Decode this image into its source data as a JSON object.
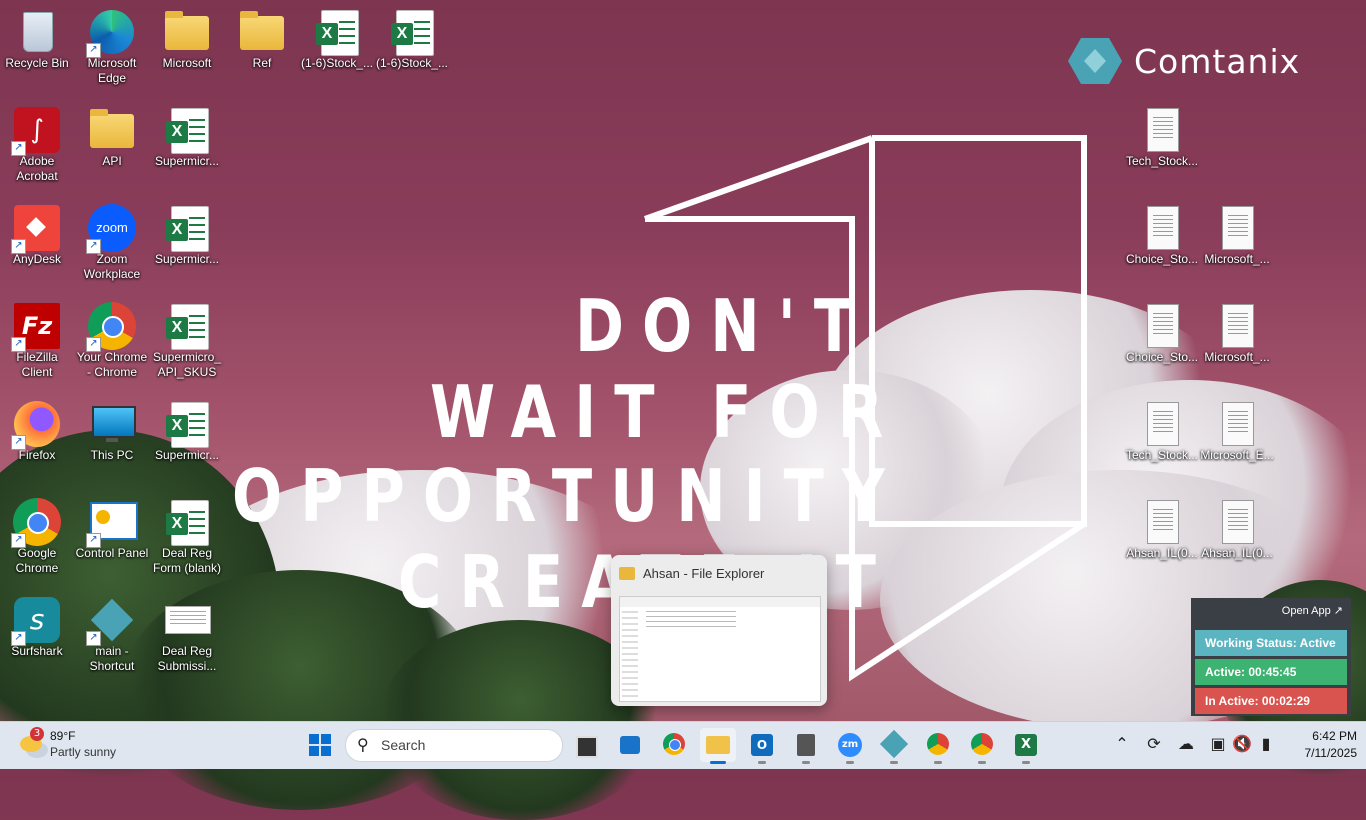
{
  "wallpaper": {
    "slogan_lines": [
      "DON'T",
      "WAIT FOR",
      "OPPORTUNITY",
      "CREATE IT"
    ],
    "brand_name": "Comtanix"
  },
  "desktop_icons": [
    {
      "label": "Recycle Bin",
      "icon": "recycle-bin-icon"
    },
    {
      "label": "Microsoft Edge",
      "icon": "edge-icon"
    },
    {
      "label": "Microsoft",
      "icon": "folder-icon"
    },
    {
      "label": "Ref",
      "icon": "folder-icon"
    },
    {
      "label": "(1-6)Stock_...",
      "icon": "excel-file-icon"
    },
    {
      "label": "(1-6)Stock_...",
      "icon": "excel-file-icon"
    },
    {
      "label": "Adobe Acrobat",
      "icon": "acrobat-icon"
    },
    {
      "label": "API",
      "icon": "folder-icon"
    },
    {
      "label": "Supermicr...",
      "icon": "excel-file-icon"
    },
    {
      "label": "AnyDesk",
      "icon": "anydesk-icon"
    },
    {
      "label": "Zoom Workplace",
      "icon": "zoom-icon"
    },
    {
      "label": "Supermicr...",
      "icon": "excel-file-icon"
    },
    {
      "label": "FileZilla Client",
      "icon": "filezilla-icon"
    },
    {
      "label": "Your Chrome - Chrome",
      "icon": "chrome-profile-icon"
    },
    {
      "label": "Supermicro_ API_SKUS",
      "icon": "excel-file-icon"
    },
    {
      "label": "Firefox",
      "icon": "firefox-icon"
    },
    {
      "label": "This PC",
      "icon": "monitor-icon"
    },
    {
      "label": "Supermicr...",
      "icon": "excel-file-icon"
    },
    {
      "label": "Google Chrome",
      "icon": "chrome-icon"
    },
    {
      "label": "Control Panel",
      "icon": "control-panel-icon"
    },
    {
      "label": "Deal Reg Form (blank)",
      "icon": "excel-file-icon"
    },
    {
      "label": "Surfshark",
      "icon": "surfshark-icon"
    },
    {
      "label": "main - Shortcut",
      "icon": "app-shortcut-icon"
    },
    {
      "label": "Deal Reg Submissi...",
      "icon": "image-file-icon"
    },
    {
      "label": "Tech_Stock...",
      "icon": "text-file-icon"
    },
    {
      "label": "Choice_Sto...",
      "icon": "text-file-icon"
    },
    {
      "label": "Microsoft_...",
      "icon": "text-file-icon"
    },
    {
      "label": "Choice_Sto...",
      "icon": "text-file-icon"
    },
    {
      "label": "Microsoft_...",
      "icon": "text-file-icon"
    },
    {
      "label": "Tech_Stock...",
      "icon": "text-file-icon"
    },
    {
      "label": "Microsoft_E...",
      "icon": "text-file-icon"
    },
    {
      "label": "Ahsan_IL(0...",
      "icon": "text-file-icon"
    },
    {
      "label": "Ahsan_IL(0...",
      "icon": "text-file-icon"
    }
  ],
  "preview": {
    "title": "Ahsan - File Explorer"
  },
  "tracker": {
    "open_app": "Open App ↗",
    "status": "Working Status: Active",
    "active": "Active: 00:45:45",
    "inactive": "In Active: 00:02:29"
  },
  "taskbar": {
    "weather_temp": "89°F",
    "weather_desc": "Partly sunny",
    "weather_badge": "3",
    "search_label": "Search",
    "time": "6:42 PM",
    "date": "7/11/2025",
    "apps": [
      "start-icon",
      "search",
      "task-view-icon",
      "store-icon",
      "chrome-icon",
      "file-explorer-icon",
      "outlook-icon",
      "calculator-icon",
      "zoom-icon",
      "app-icon",
      "chrome-icon",
      "chrome-icon",
      "excel-icon"
    ]
  },
  "colors": {
    "accent": "#4aa3b5",
    "active_green": "#3cb371",
    "inactive_red": "#d9534f",
    "status_teal": "#5bb5c0"
  }
}
